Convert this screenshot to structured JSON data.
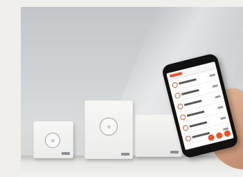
{
  "scene": {
    "subject": "smart-home-devices-and-phone",
    "colors": {
      "background": "#f1efeb",
      "wall": "#d1d4d6",
      "device": "#f4f4f2",
      "accent": "#e8542b",
      "skin": "#d8a98b"
    },
    "icons": [
      "dial-icon",
      "logo-mark"
    ]
  }
}
